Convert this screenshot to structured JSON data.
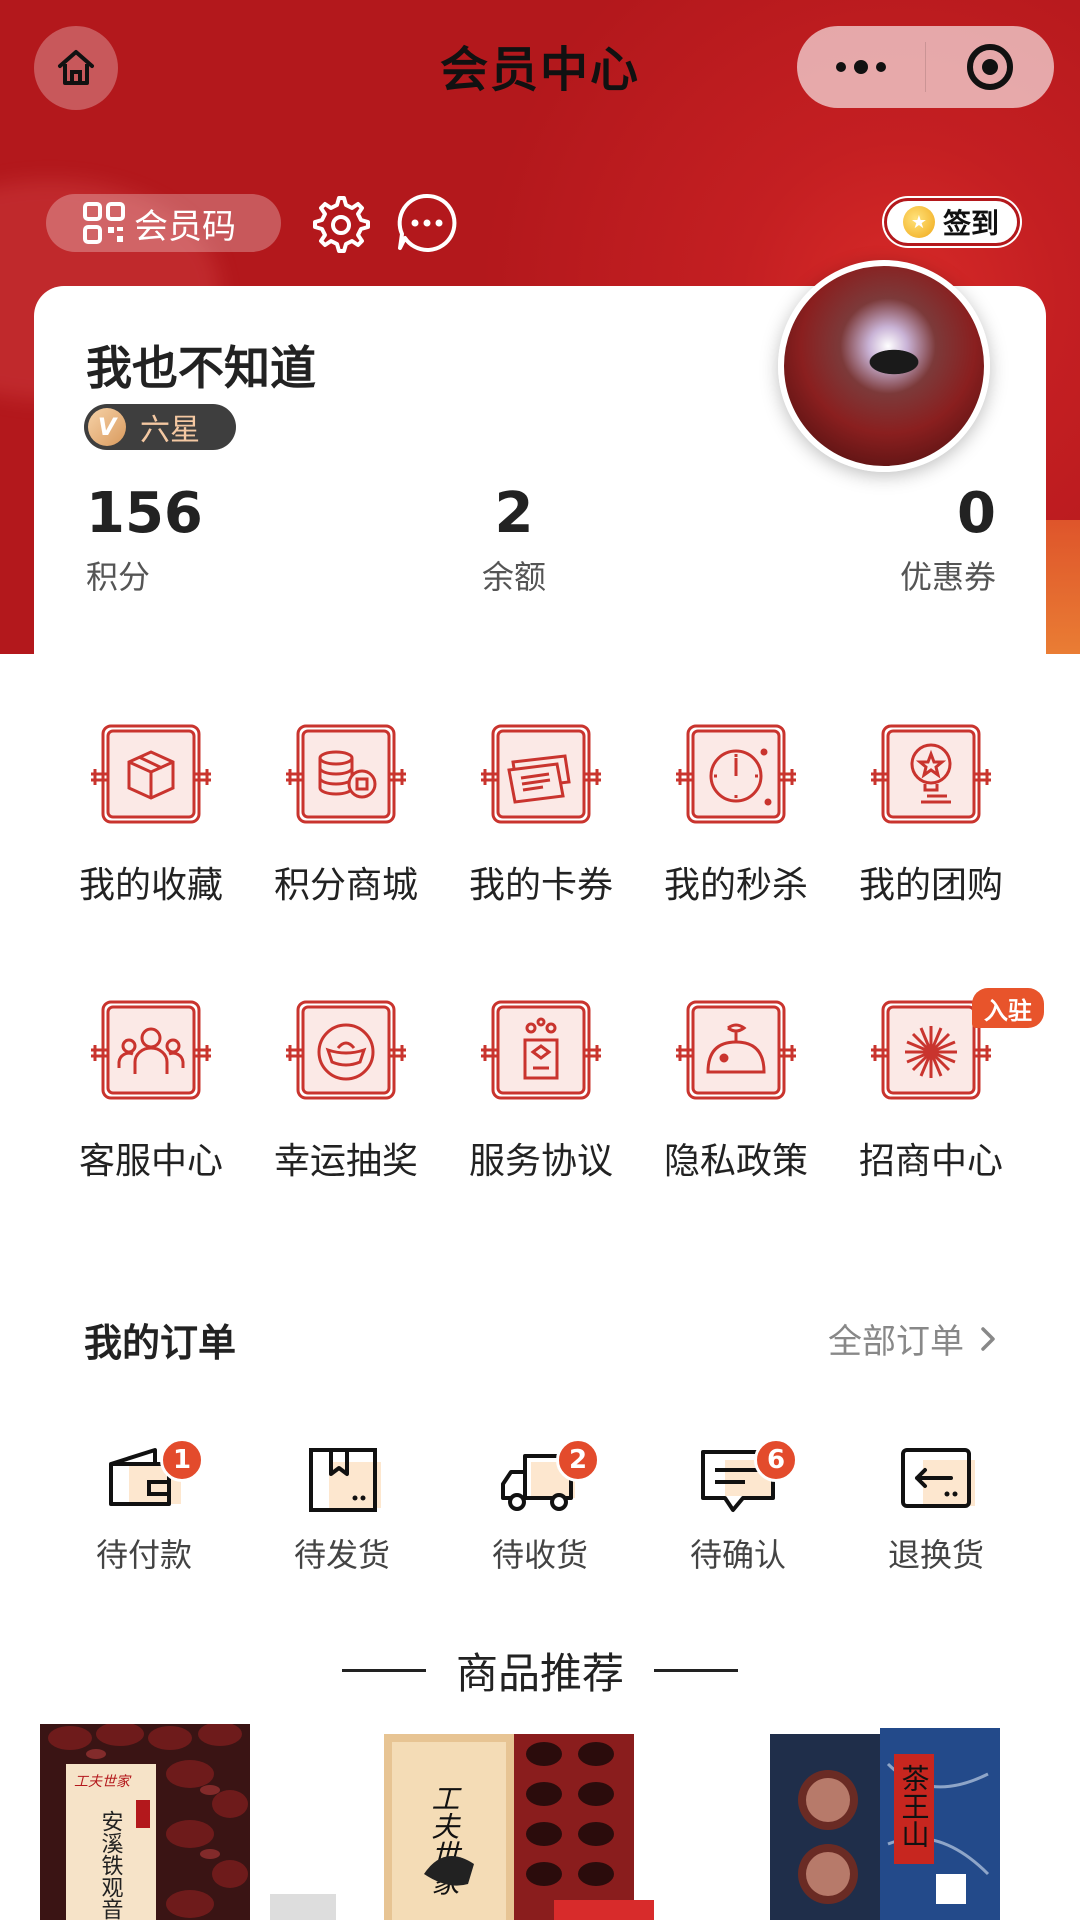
{
  "nav": {
    "title": "会员中心"
  },
  "topbar": {
    "member_code_label": "会员码",
    "signin_label": "签到"
  },
  "profile": {
    "username": "我也不知道",
    "level_badge": "V",
    "level": "六星",
    "stats": [
      {
        "value": "156",
        "label": "积分"
      },
      {
        "value": "2",
        "label": "余额"
      },
      {
        "value": "0",
        "label": "优惠券"
      }
    ]
  },
  "services": {
    "row1": [
      {
        "label": "我的收藏",
        "icon": "package-box-icon"
      },
      {
        "label": "积分商城",
        "icon": "coins-icon"
      },
      {
        "label": "我的卡券",
        "icon": "ticket-icon"
      },
      {
        "label": "我的秒杀",
        "icon": "clock-icon"
      },
      {
        "label": "我的团购",
        "icon": "star-badge-icon"
      }
    ],
    "row2": [
      {
        "label": "客服中心",
        "icon": "people-icon"
      },
      {
        "label": "幸运抽奖",
        "icon": "gold-ingot-icon"
      },
      {
        "label": "服务协议",
        "icon": "contract-icon"
      },
      {
        "label": "隐私政策",
        "icon": "mouse-icon"
      },
      {
        "label": "招商中心",
        "icon": "firework-icon",
        "tag": "入驻"
      }
    ]
  },
  "orders": {
    "title": "我的订单",
    "all_label": "全部订单",
    "items": [
      {
        "label": "待付款",
        "badge": "1",
        "icon": "wallet-icon"
      },
      {
        "label": "待发货",
        "badge": "",
        "icon": "box-icon"
      },
      {
        "label": "待收货",
        "badge": "2",
        "icon": "truck-icon"
      },
      {
        "label": "待确认",
        "badge": "6",
        "icon": "message-icon"
      },
      {
        "label": "退换货",
        "badge": "",
        "icon": "return-icon"
      }
    ]
  },
  "recommend": {
    "title": "商品推荐",
    "product_texts": [
      "工夫世家",
      "安溪铁观音",
      "工夫世家",
      "茶王山"
    ]
  },
  "colors": {
    "brand_red": "#b3181c",
    "icon_red": "#c9342e",
    "badge_orange": "#e34b2c"
  }
}
